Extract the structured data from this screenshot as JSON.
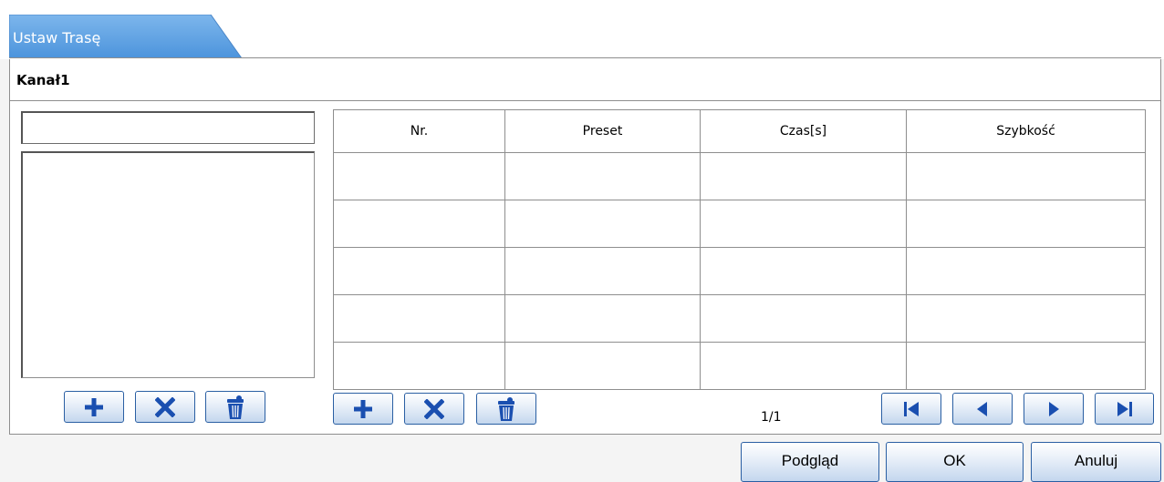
{
  "tab": {
    "label": "Ustaw Trasę"
  },
  "channel": {
    "title": "Kanał1"
  },
  "route_name_input": {
    "value": ""
  },
  "table": {
    "columns": [
      "Nr.",
      "Preset",
      "Czas[s]",
      "Szybkość"
    ],
    "rows": [
      [
        "",
        "",
        "",
        ""
      ],
      [
        "",
        "",
        "",
        ""
      ],
      [
        "",
        "",
        "",
        ""
      ],
      [
        "",
        "",
        "",
        ""
      ],
      [
        "",
        "",
        "",
        ""
      ]
    ]
  },
  "pagination": {
    "text": "1/1"
  },
  "icons": {
    "add": "plus-icon",
    "delete": "x-icon",
    "clear": "trash-icon",
    "first": "first-page-icon",
    "prev": "prev-page-icon",
    "next": "next-page-icon",
    "last": "last-page-icon"
  },
  "footer": {
    "preview_label": "Podgląd",
    "ok_label": "OK",
    "cancel_label": "Anuluj"
  },
  "colors": {
    "tab_fill": "#5a9fe0",
    "icon_blue": "#1a4fb0",
    "button_border": "#2a5fa3",
    "panel_border": "#8e8e8e"
  }
}
